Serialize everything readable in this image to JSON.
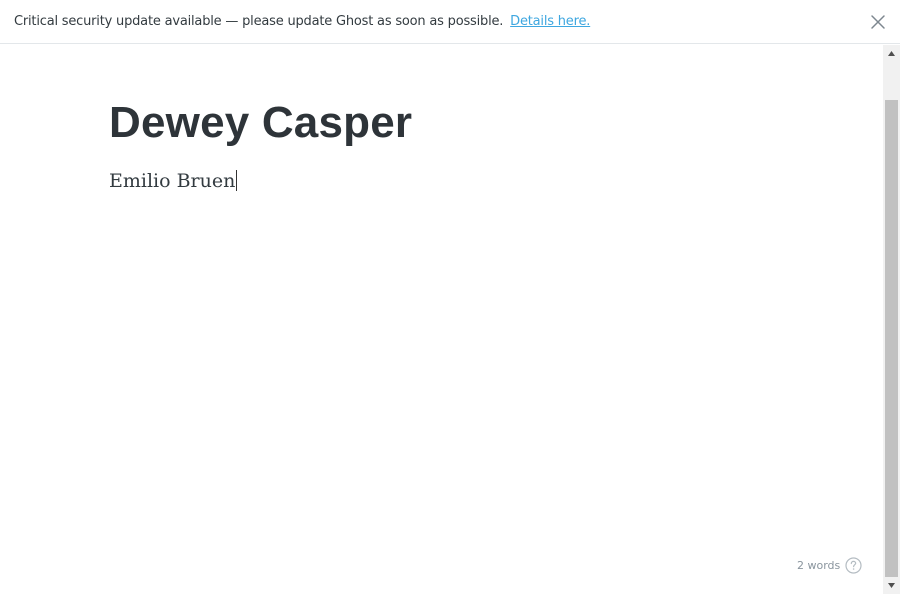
{
  "notice": {
    "message": "Critical security update available — please update Ghost as soon as possible.",
    "link_label": "Details here."
  },
  "editor": {
    "title": "Dewey Casper",
    "body": "Emilio Bruen"
  },
  "footer": {
    "word_count": "2 words"
  },
  "icons": {
    "close": "close-icon",
    "help": "question-circle-icon"
  },
  "colors": {
    "link": "#3ea7e0",
    "title": "#2e3439",
    "muted": "#8a959e"
  }
}
